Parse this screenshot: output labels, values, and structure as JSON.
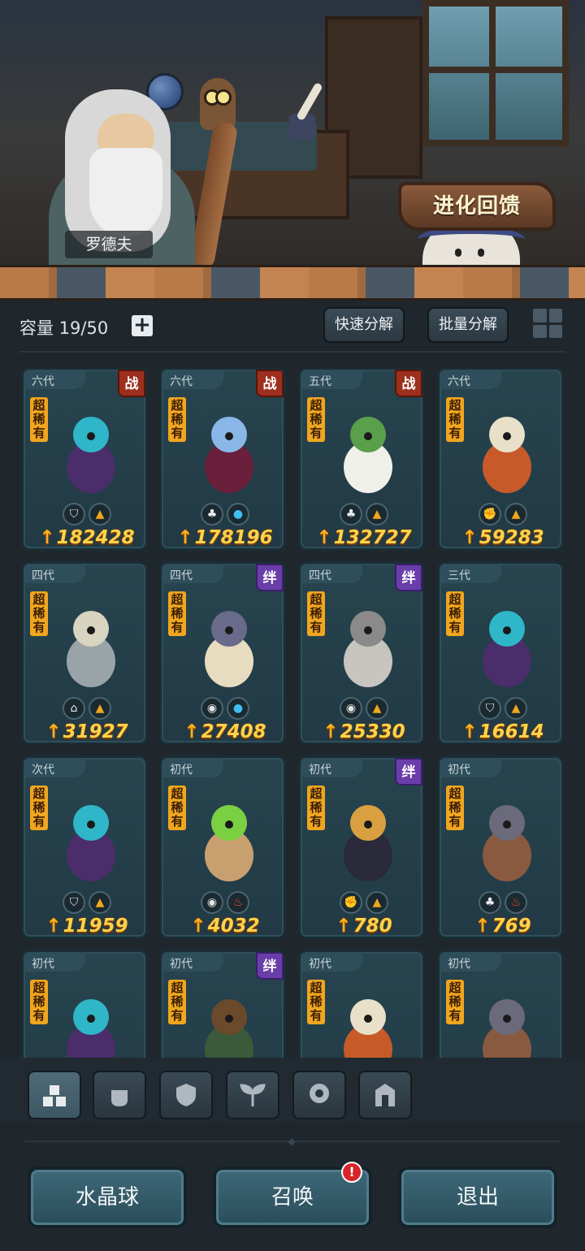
{
  "scene": {
    "npc_name": "罗德夫",
    "evolution_button": "进化回馈"
  },
  "toolbar": {
    "capacity_label": "容量 19/50",
    "add_icon": "+",
    "quick_decompose": "快速分解",
    "batch_decompose": "批量分解",
    "view_toggle_icon": "grid-icon"
  },
  "cards": [
    {
      "gen": "六代",
      "rarity": "超稀有",
      "tag": "战",
      "tag_type": "war",
      "attrs": [
        "shield",
        "earth"
      ],
      "power": "182428",
      "creature": "dark-flower-girl"
    },
    {
      "gen": "六代",
      "rarity": "超稀有",
      "tag": "战",
      "tag_type": "war",
      "attrs": [
        "grass",
        "water"
      ],
      "power": "178196",
      "creature": "crystal-queen"
    },
    {
      "gen": "五代",
      "rarity": "超稀有",
      "tag": "战",
      "tag_type": "war",
      "attrs": [
        "grass",
        "earth"
      ],
      "power": "132727",
      "creature": "white-owl-sage"
    },
    {
      "gen": "六代",
      "rarity": "超稀有",
      "tag": "",
      "tag_type": "",
      "attrs": [
        "fist",
        "earth"
      ],
      "power": "59283",
      "creature": "hooded-blob"
    },
    {
      "gen": "四代",
      "rarity": "超稀有",
      "tag": "",
      "tag_type": "",
      "attrs": [
        "tower",
        "earth"
      ],
      "power": "31927",
      "creature": "armored-rat"
    },
    {
      "gen": "四代",
      "rarity": "超稀有",
      "tag": "绊",
      "tag_type": "bond",
      "attrs": [
        "spirit",
        "water"
      ],
      "power": "27408",
      "creature": "sea-serpent"
    },
    {
      "gen": "四代",
      "rarity": "超稀有",
      "tag": "绊",
      "tag_type": "bond",
      "attrs": [
        "spirit",
        "earth"
      ],
      "power": "25330",
      "creature": "winged-beast"
    },
    {
      "gen": "三代",
      "rarity": "超稀有",
      "tag": "",
      "tag_type": "",
      "attrs": [
        "shield",
        "earth"
      ],
      "power": "16614",
      "creature": "dark-flower-girl"
    },
    {
      "gen": "次代",
      "rarity": "超稀有",
      "tag": "",
      "tag_type": "",
      "attrs": [
        "shield",
        "earth"
      ],
      "power": "11959",
      "creature": "dark-flower-girl"
    },
    {
      "gen": "初代",
      "rarity": "超稀有",
      "tag": "",
      "tag_type": "",
      "attrs": [
        "spirit",
        "fire"
      ],
      "power": "4032",
      "creature": "mech-lizard"
    },
    {
      "gen": "初代",
      "rarity": "超稀有",
      "tag": "绊",
      "tag_type": "bond",
      "attrs": [
        "fist",
        "earth"
      ],
      "power": "780",
      "creature": "shadow-wolf"
    },
    {
      "gen": "初代",
      "rarity": "超稀有",
      "tag": "",
      "tag_type": "",
      "attrs": [
        "grass",
        "fire"
      ],
      "power": "769",
      "creature": "rock-golem"
    },
    {
      "gen": "初代",
      "rarity": "超稀有",
      "tag": "",
      "tag_type": "",
      "attrs": [],
      "power": "",
      "creature": "dark-flower-girl"
    },
    {
      "gen": "初代",
      "rarity": "超稀有",
      "tag": "绊",
      "tag_type": "bond",
      "attrs": [],
      "power": "",
      "creature": "moss-troll"
    },
    {
      "gen": "初代",
      "rarity": "超稀有",
      "tag": "",
      "tag_type": "",
      "attrs": [],
      "power": "",
      "creature": "hooded-blob"
    },
    {
      "gen": "初代",
      "rarity": "超稀有",
      "tag": "",
      "tag_type": "",
      "attrs": [],
      "power": "",
      "creature": "rock-golem"
    }
  ],
  "filters": [
    "all-icon",
    "fist-icon",
    "shield-icon",
    "sprout-icon",
    "spirit-icon",
    "tower-icon"
  ],
  "bottom_buttons": {
    "crystal_ball": "水晶球",
    "summon": "召唤",
    "summon_alert": "!",
    "exit": "退出"
  },
  "colors": {
    "panel_bg": "#1f272d",
    "card_bg": "#27444f",
    "rarity_badge": "#f0a61e",
    "war_tag": "#9c2f1e",
    "bond_tag": "#6a3ea8",
    "power_text": "#ffd34a"
  }
}
